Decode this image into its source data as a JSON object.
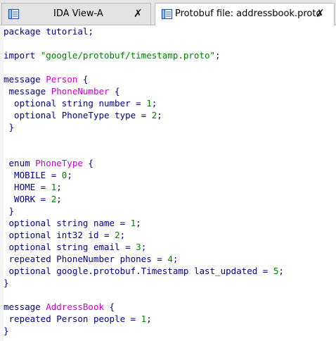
{
  "tabs": [
    {
      "label": "IDA View-A",
      "active": false
    },
    {
      "label": "Protobuf file: addressbook.proto",
      "active": true
    }
  ],
  "close_glyph": "✗",
  "colors": {
    "keyword": "#000080",
    "message_name": "#cc00cc",
    "string": "#008000",
    "number": "#008000"
  },
  "code_lines": [
    [
      [
        "kw",
        "package tutorial"
      ],
      [
        "pn",
        ";"
      ]
    ],
    [],
    [
      [
        "kw",
        "import "
      ],
      [
        "st",
        "\"google/protobuf/timestamp.proto\""
      ],
      [
        "pn",
        ";"
      ]
    ],
    [],
    [
      [
        "kw",
        "message "
      ],
      [
        "nm",
        "Person"
      ],
      [
        "pn",
        " {"
      ]
    ],
    [
      [
        "kw",
        " message "
      ],
      [
        "nm",
        "PhoneNumber"
      ],
      [
        "pn",
        " {"
      ]
    ],
    [
      [
        "kw",
        "  optional string "
      ],
      [
        "id",
        "number"
      ],
      [
        "pn",
        " = "
      ],
      [
        "num",
        "1"
      ],
      [
        "pn",
        ";"
      ]
    ],
    [
      [
        "kw",
        "  optional PhoneType "
      ],
      [
        "id",
        "type"
      ],
      [
        "pn",
        " = "
      ],
      [
        "num",
        "2"
      ],
      [
        "pn",
        ";"
      ]
    ],
    [
      [
        "pn",
        " }"
      ]
    ],
    [],
    [],
    [
      [
        "kw",
        " enum "
      ],
      [
        "nm",
        "PhoneType"
      ],
      [
        "pn",
        " {"
      ]
    ],
    [
      [
        "id",
        "  MOBILE"
      ],
      [
        "pn",
        " = "
      ],
      [
        "num",
        "0"
      ],
      [
        "pn",
        ";"
      ]
    ],
    [
      [
        "id",
        "  HOME"
      ],
      [
        "pn",
        " = "
      ],
      [
        "num",
        "1"
      ],
      [
        "pn",
        ";"
      ]
    ],
    [
      [
        "id",
        "  WORK"
      ],
      [
        "pn",
        " = "
      ],
      [
        "num",
        "2"
      ],
      [
        "pn",
        ";"
      ]
    ],
    [
      [
        "pn",
        " }"
      ]
    ],
    [
      [
        "kw",
        " optional string "
      ],
      [
        "id",
        "name"
      ],
      [
        "pn",
        " = "
      ],
      [
        "num",
        "1"
      ],
      [
        "pn",
        ";"
      ]
    ],
    [
      [
        "kw",
        " optional int32 "
      ],
      [
        "id",
        "id"
      ],
      [
        "pn",
        " = "
      ],
      [
        "num",
        "2"
      ],
      [
        "pn",
        ";"
      ]
    ],
    [
      [
        "kw",
        " optional string "
      ],
      [
        "id",
        "email"
      ],
      [
        "pn",
        " = "
      ],
      [
        "num",
        "3"
      ],
      [
        "pn",
        ";"
      ]
    ],
    [
      [
        "kw",
        " repeated PhoneNumber "
      ],
      [
        "id",
        "phones"
      ],
      [
        "pn",
        " = "
      ],
      [
        "num",
        "4"
      ],
      [
        "pn",
        ";"
      ]
    ],
    [
      [
        "kw",
        " optional google.protobuf.Timestamp "
      ],
      [
        "id",
        "last_updated"
      ],
      [
        "pn",
        " = "
      ],
      [
        "num",
        "5"
      ],
      [
        "pn",
        ";"
      ]
    ],
    [
      [
        "pn",
        "}"
      ]
    ],
    [],
    [
      [
        "kw",
        "message "
      ],
      [
        "nm",
        "AddressBook"
      ],
      [
        "pn",
        " {"
      ]
    ],
    [
      [
        "kw",
        " repeated Person "
      ],
      [
        "id",
        "people"
      ],
      [
        "pn",
        " = "
      ],
      [
        "num",
        "1"
      ],
      [
        "pn",
        ";"
      ]
    ],
    [
      [
        "pn",
        "}"
      ]
    ]
  ]
}
